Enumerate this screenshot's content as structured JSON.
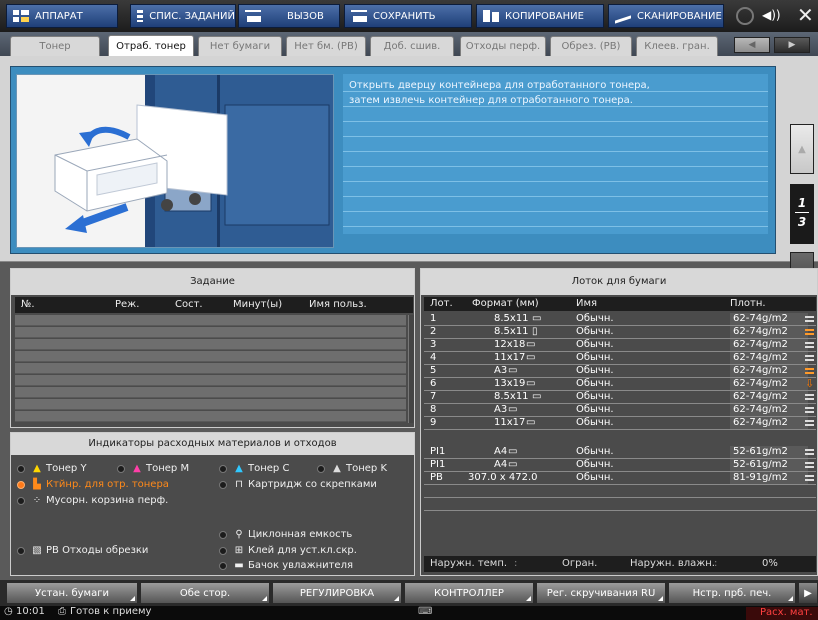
{
  "toolbar": {
    "machine": "АППАРАТ",
    "job_list": "СПИС. ЗАДАНИЙ",
    "recall": "ВЫЗОВ",
    "save": "СОХРАНИТЬ",
    "copy": "КОПИРОВАНИЕ",
    "scan": "СКАНИРОВАНИЕ",
    "close": "✕",
    "speaker": "◀))"
  },
  "tabs": [
    "Тонер",
    "Отраб. тонер",
    "Нет бумаги",
    "Нет бм. (PB)",
    "Доб. сшив.",
    "Отходы перф.",
    "Обрез. (PB)",
    "Клеев. гран."
  ],
  "tab_nav": {
    "prev": "◀",
    "next": "▶"
  },
  "guide": {
    "message_line1": "Открыть дверцу контейнера для отработанного тонера,",
    "message_line2": "затем извлечь контейнер для отработанного тонера.",
    "page_current": "1",
    "page_total": "3",
    "up": "▲",
    "down": "▼"
  },
  "job_panel": {
    "title": "Задание",
    "columns": [
      "№.",
      "Реж.",
      "Сост.",
      "Минут(ы)",
      "Имя польз."
    ]
  },
  "consumables": {
    "title": "Индикаторы расходных материалов и отходов",
    "items": [
      "Тонер Y",
      "Тонер M",
      "Тонер C",
      "Тонер K",
      "Ктйнр. для отр. тонера",
      "Картридж со скрепками",
      "Мусорн. корзина перф.",
      "Циклонная емкость",
      "РВ Отходы обрезки",
      "Клей для уст.кл.скр.",
      "Бачок увлажнителя"
    ]
  },
  "tray_panel": {
    "title": "Лоток для бумаги",
    "columns": [
      "Лот.",
      "Формат (мм)",
      "Имя",
      "Плотн."
    ],
    "rows": [
      {
        "tray": "1",
        "size": "8.5x11",
        "orient": "▭",
        "name": "Обычн.",
        "weight": "62-74g/m2"
      },
      {
        "tray": "2",
        "size": "8.5x11",
        "orient": "▯",
        "name": "Обычн.",
        "weight": "62-74g/m2"
      },
      {
        "tray": "3",
        "size": "12x18",
        "orient": "▭",
        "name": "Обычн.",
        "weight": "62-74g/m2"
      },
      {
        "tray": "4",
        "size": "11x17",
        "orient": "▭",
        "name": "Обычн.",
        "weight": "62-74g/m2"
      },
      {
        "tray": "5",
        "size": "A3",
        "orient": "▭",
        "name": "Обычн.",
        "weight": "62-74g/m2"
      },
      {
        "tray": "6",
        "size": "13x19",
        "orient": "▭",
        "name": "Обычн.",
        "weight": "62-74g/m2"
      },
      {
        "tray": "7",
        "size": "8.5x11",
        "orient": "▭",
        "name": "Обычн.",
        "weight": "62-74g/m2"
      },
      {
        "tray": "8",
        "size": "A3",
        "orient": "▭",
        "name": "Обычн.",
        "weight": "62-74g/m2"
      },
      {
        "tray": "9",
        "size": "11x17",
        "orient": "▭",
        "name": "Обычн.",
        "weight": "62-74g/m2"
      },
      {
        "tray": "PI1",
        "size": "A4",
        "orient": "▭",
        "name": "Обычн.",
        "weight": "52-61g/m2"
      },
      {
        "tray": "PI1",
        "size": "A4",
        "orient": "▭",
        "name": "Обычн.",
        "weight": "52-61g/m2"
      },
      {
        "tray": "PB",
        "size": "307.0 x 472.0",
        "orient": "",
        "name": "Обычн.",
        "weight": "81-91g/m2"
      }
    ],
    "ext_temp_label": "Наружн. темп.",
    "ext_temp_value": "Огран.",
    "ext_hum_label": "Наружн. влажн.",
    "ext_hum_value": "0%"
  },
  "bottom": {
    "paper_setting": "Устан. бумаги",
    "duplex": "Обе стор.",
    "adjust": "РЕГУЛИРОВКА",
    "controller": "КОНТРОЛЛЕР",
    "curl": "Рег. скручивания RU",
    "print_settings": "Нстр. прб. печ.",
    "next": "▶"
  },
  "status": {
    "time": "10:01",
    "state": "Готов к приему",
    "consumables": "Расх. мат."
  },
  "colors": {
    "accent": "#3d8dbf",
    "warning": "#ff7a1a"
  }
}
